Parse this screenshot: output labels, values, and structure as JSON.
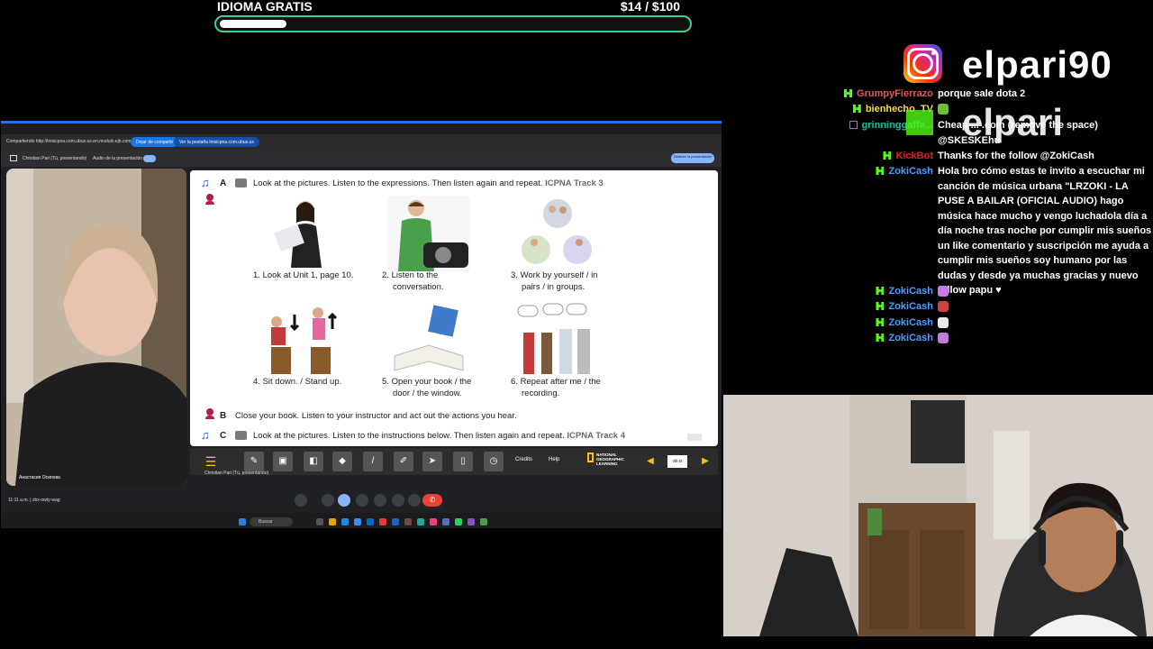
{
  "goal": {
    "title": "IDIOMA GRATIS",
    "amount": "$14  / $100",
    "progress": 0.14,
    "accent": "#3fcf8e"
  },
  "social": {
    "instagram_handle": "elpari90",
    "overlay_text": "elpari"
  },
  "chat": [
    {
      "platform": "kick",
      "user": "GrumpyFierrazo",
      "color": "#e35a5a",
      "message": "porque sale dota 2"
    },
    {
      "platform": "kick",
      "user": "bienhecho_TV",
      "color": "#ffd84d",
      "message": ""
    },
    {
      "platform": "twitch",
      "user": "grinninggaffe...",
      "color": "#00c8a0",
      "message": "Cheap ... .com (remove the space) @SKESKEhu"
    },
    {
      "platform": "kick",
      "user": "KickBot",
      "color": "#e02020",
      "message": "Thanks for the follow @ZokiCash"
    },
    {
      "platform": "kick",
      "user": "ZokiCash",
      "color": "#4d9fff",
      "message": "Hola bro cómo estas te invito a escuchar mi canción de música urbana \"LRZOKI - LA PUSE A BAILAR (OFICIAL AUDIO) hago música hace mucho y vengo luchadola día a día noche tras noche por cumplir mis sueños un like comentario y suscripción me ayuda a cumplir mis sueños soy humano por las dudas y desde ya muchas gracias y nuevo follow papu ♥"
    },
    {
      "platform": "kick",
      "user": "ZokiCash",
      "color": "#4d9fff",
      "message": ""
    },
    {
      "platform": "kick",
      "user": "ZokiCash",
      "color": "#4d9fff",
      "message": ""
    },
    {
      "platform": "kick",
      "user": "ZokiCash",
      "color": "#4d9fff",
      "message": ""
    },
    {
      "platform": "kick",
      "user": "ZokiCash",
      "color": "#4d9fff",
      "message": ""
    }
  ],
  "window": {
    "url": "Compartiendo http://lmsicpna.com.ubus.us.en.modulo.ejb.com",
    "stop_sharing": "Dejar de compartir",
    "switch_tab": "Ver la pestaña lmsicpna.com.ubus.us",
    "presenter": "Christian Pari (Tú, presentando)",
    "audio_label": "Audio de la presentación",
    "stop_presenting": "Detener la presentación",
    "tile_name": "Анастасия Осипова",
    "presenting_label": "Christian Pari (Tú, presentando)",
    "time": "11:11 a.m.  |  zbx-owty-wag",
    "search": "Buscar"
  },
  "slide": {
    "section_a": {
      "letter": "A",
      "text": "Look at the pictures. Listen to the expressions. Then listen again and repeat.",
      "track": "ICPNA Track 3"
    },
    "items": [
      {
        "num": "1.",
        "line1": "Look at Unit 1, page 10.",
        "line2": ""
      },
      {
        "num": "2.",
        "line1": "Listen to the",
        "line2": "conversation."
      },
      {
        "num": "3.",
        "line1": "Work by yourself / in",
        "line2": "pairs / in groups."
      },
      {
        "num": "4.",
        "line1": "Sit down. / Stand up.",
        "line2": ""
      },
      {
        "num": "5.",
        "line1": "Open your book / the",
        "line2": "door / the window."
      },
      {
        "num": "6.",
        "line1": "Repeat after me / the",
        "line2": "recording."
      }
    ],
    "section_b": {
      "letter": "B",
      "text": "Close your book. Listen to your instructor and act out the actions you hear."
    },
    "section_c": {
      "letter": "C",
      "text": "Look at the pictures. Listen to the instructions below. Then listen again and repeat.",
      "track": "ICPNA Track 4"
    }
  },
  "toolbar": {
    "credits": "Credits",
    "help": "Help",
    "brand": "NATIONAL GEOGRAPHIC LEARNING",
    "page": "viii-ix"
  }
}
